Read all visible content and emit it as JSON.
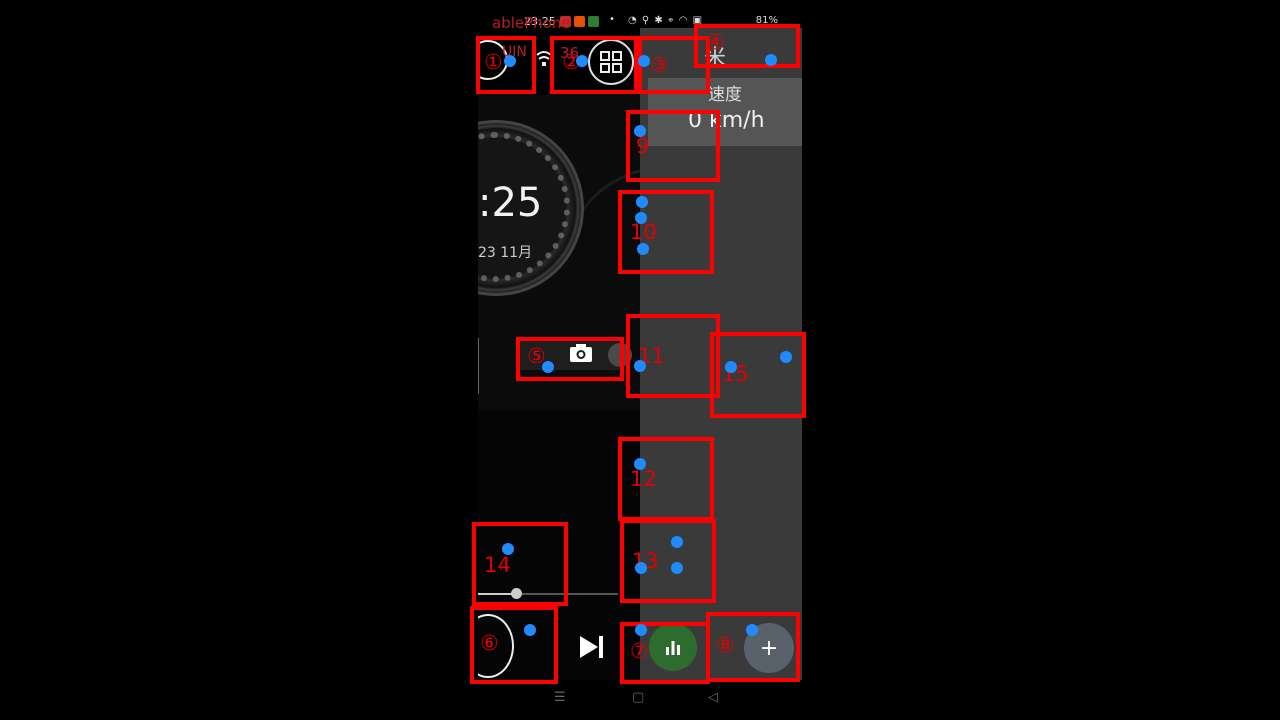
{
  "status_bar": {
    "time": "23:25",
    "indicators": "◔ ⚲ ✱ ⌖ ◠ ▣",
    "battery": "81%"
  },
  "app": {
    "red_title": "ablePhone",
    "net_text": "UIN",
    "net_number": "36"
  },
  "dashboard": {
    "clock": ":25",
    "date": "23 11月"
  },
  "right_panel": {
    "meter_label": "米",
    "speed_label": "速度",
    "speed_value": "0 km/h"
  },
  "media": {
    "progress": 0.27
  },
  "fab_add_label": "+",
  "nav": {
    "menu": "☰",
    "home": "▢",
    "back": "◁"
  },
  "annotations": {
    "boxes": [
      {
        "label": "①"
      },
      {
        "label": "②"
      },
      {
        "label": "③"
      },
      {
        "label": "④"
      },
      {
        "label": "⑤"
      },
      {
        "label": "⑥"
      },
      {
        "label": "⑦"
      },
      {
        "label": "⑧"
      },
      {
        "label": "9"
      },
      {
        "label": "10"
      },
      {
        "label": "11"
      },
      {
        "label": "12"
      },
      {
        "label": "13"
      },
      {
        "label": "14"
      },
      {
        "label": "15"
      }
    ]
  }
}
